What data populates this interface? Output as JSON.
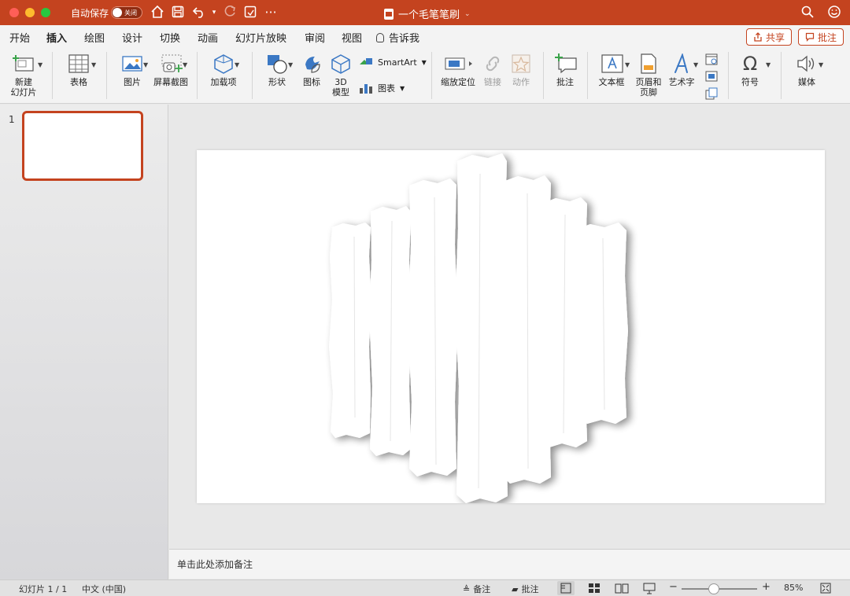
{
  "titlebar": {
    "autosave_label": "自动保存",
    "autosave_toggle": "关闭",
    "doc_title": "一个毛笔笔刷",
    "accent": "#c4431f"
  },
  "tabs": [
    {
      "label": "开始"
    },
    {
      "label": "插入"
    },
    {
      "label": "绘图"
    },
    {
      "label": "设计"
    },
    {
      "label": "切换"
    },
    {
      "label": "动画"
    },
    {
      "label": "幻灯片放映"
    },
    {
      "label": "审阅"
    },
    {
      "label": "视图"
    }
  ],
  "tell_me": "告诉我",
  "actions": {
    "share": "共享",
    "comment": "批注"
  },
  "ribbon": {
    "new_slide_1": "新建",
    "new_slide_2": "幻灯片",
    "table": "表格",
    "picture": "图片",
    "screenshot": "屏幕截图",
    "addins": "加载项",
    "shapes": "形状",
    "icons": "图标",
    "model3d_1": "3D",
    "model3d_2": "模型",
    "smartart": "SmartArt",
    "chart": "图表",
    "zoom": "缩放定位",
    "link": "链接",
    "action": "动作",
    "comment": "批注",
    "textbox": "文本框",
    "header_footer_1": "页眉和",
    "header_footer_2": "页脚",
    "wordart": "艺术字",
    "symbol": "符号",
    "media": "媒体"
  },
  "slides": {
    "number": "1"
  },
  "notes_placeholder": "单击此处添加备注",
  "status": {
    "slide_info": "幻灯片 1 / 1",
    "language": "中文 (中国)",
    "notes": "备注",
    "comments": "批注",
    "zoom": "85%"
  }
}
